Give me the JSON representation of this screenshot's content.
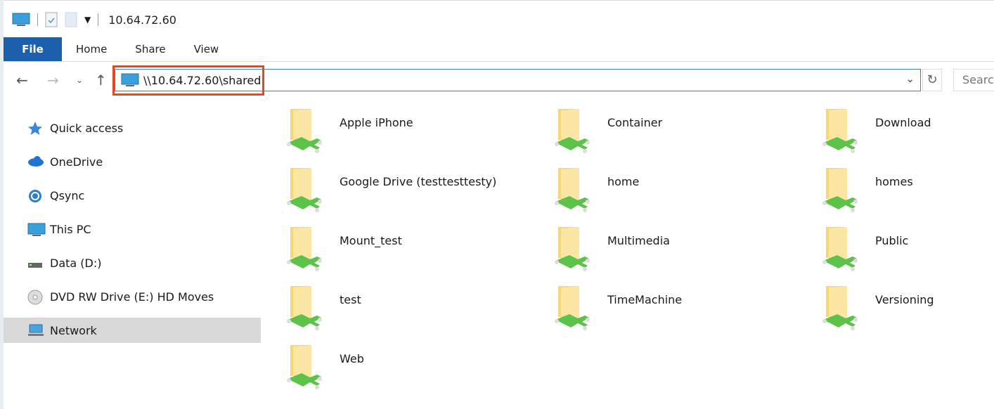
{
  "window": {
    "title": "10.64.72.60"
  },
  "ribbon": {
    "tabs": [
      "File",
      "Home",
      "Share",
      "View"
    ]
  },
  "address": {
    "path": "\\\\10.64.72.60\\shared",
    "search_placeholder": "Search"
  },
  "nav_pane": {
    "items": [
      {
        "label": "Quick access",
        "icon": "star-icon"
      },
      {
        "label": "OneDrive",
        "icon": "cloud-icon"
      },
      {
        "label": "Qsync",
        "icon": "sync-icon"
      },
      {
        "label": "This PC",
        "icon": "monitor-icon"
      },
      {
        "label": "Data (D:)",
        "icon": "drive-icon"
      },
      {
        "label": "DVD RW Drive (E:) HD Moves",
        "icon": "disc-icon"
      },
      {
        "label": "Network",
        "icon": "network-icon",
        "selected": true
      }
    ]
  },
  "folders": [
    "Apple iPhone",
    "Container",
    "Download",
    "Google Drive (testtesttesty)",
    "home",
    "homes",
    "Mount_test",
    "Multimedia",
    "Public",
    "test",
    "TimeMachine",
    "Versioning",
    "Web"
  ],
  "colors": {
    "accent": "#1c5fad",
    "highlight": "#e8461c"
  }
}
